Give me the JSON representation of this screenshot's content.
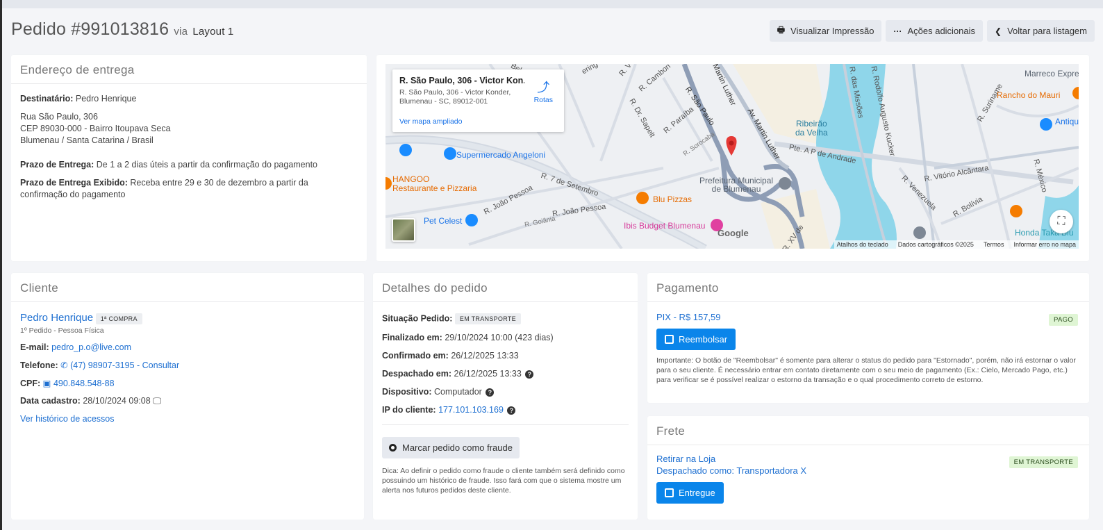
{
  "header": {
    "title": "Pedido #991013816",
    "via": "via",
    "layout": "Layout 1",
    "buttons": {
      "print": "Visualizar Impressão",
      "actions": "Ações adicionais",
      "back": "Voltar para listagem"
    }
  },
  "entrega": {
    "title": "Endereço de entrega",
    "destinatario_label": "Destinatário:",
    "destinatario": "Pedro Henrique",
    "line1": "Rua São Paulo, 306",
    "line2": "CEP 89030-000 - Bairro Itoupava Seca",
    "line3": "Blumenau / Santa Catarina / Brasil",
    "prazo_label": "Prazo de Entrega:",
    "prazo": "De 1 a 2 dias úteis a partir da confirmação do pagamento",
    "prazo_exibido_label": "Prazo de Entrega Exibido:",
    "prazo_exibido": "Receba entre 29 e 30 de dezembro a partir da confirmação do pagamento"
  },
  "map": {
    "popup_title": "R. São Paulo, 306 - Victor Kon...",
    "popup_address": "R. São Paulo, 306 - Victor Konder, Blumenau - SC, 89012-001",
    "popup_link": "Ver mapa ampliado",
    "rotas": "Rotas",
    "places": {
      "angeloni": "Supermercado Angeloni",
      "hangoo1": "HANGOO",
      "hangoo2": "Restaurante e Pizzaria",
      "petcelest": "Pet Celest",
      "blupizzas": "Blu Pizzas",
      "ibis": "Ibis Budget Blumenau",
      "prefeitura1": "Prefeitura Municipal",
      "prefeitura2": "de Blumenau",
      "ribeirao1": "Ribeirão",
      "ribeirao2": "da Velha",
      "marreco": "Marreco Express",
      "rancho": "Rancho do Mauri",
      "honda": "Honda Taka Blu",
      "antiq": "Antiqu de Blu"
    },
    "streets": {
      "saopaulo": "R. São Paulo",
      "martin": "Av. Martin Luther",
      "martin2": "Martin Luther",
      "setembro": "R. 7 de Setembro",
      "joaopessoa": "R. João Pessoa",
      "joaopessoa2": "R. João Pessoa",
      "goiania": "R. Goiânia",
      "pte": "Pte. A P de Andrade",
      "alcantara": "R. Vitório Alcântara",
      "venezuela": "R. Venezuela",
      "bolivia": "R. Bolívia",
      "missoes": "R. das Missões",
      "kucker": "R. Rodolfo Augusto Kucker",
      "paraiba": "R. Paraíba",
      "sorocaba": "R. Sorocaba",
      "sapelt": "R. Dr. Sapelt",
      "suriname": "R. Suriname",
      "mexico": "R. México",
      "xv": "R. XV de",
      "cambori": "R. Cambori",
      "ering": "ering",
      "rv": "R. V",
      "bel": "Bel"
    },
    "google": "Google",
    "footer": [
      "Atalhos do teclado",
      "Dados cartográficos ©2025",
      "Termos",
      "Informar erro no mapa"
    ]
  },
  "cliente": {
    "title": "Cliente",
    "name": "Pedro Henrique",
    "badge": "1ª COMPRA",
    "sub": "1º Pedido - Pessoa Física",
    "email_label": "E-mail:",
    "email": "pedro_p.o@live.com",
    "telefone_label": "Telefone:",
    "telefone": "(47) 98907-3195 - Consultar",
    "cpf_label": "CPF:",
    "cpf": "490.848.548-88",
    "cadastro_label": "Data cadastro:",
    "cadastro": "28/10/2024 09:08",
    "historico": "Ver histórico de acessos"
  },
  "detalhes": {
    "title": "Detalhes do pedido",
    "situacao_label": "Situação Pedido:",
    "situacao": "EM TRANSPORTE",
    "finalizado_label": "Finalizado em:",
    "finalizado": "29/10/2024 10:00 (423 dias)",
    "confirmado_label": "Confirmado em:",
    "confirmado": "26/12/2025 13:33",
    "despachado_label": "Despachado em:",
    "despachado": "26/12/2025 13:33",
    "dispositivo_label": "Dispositivo:",
    "dispositivo": "Computador",
    "ip_label": "IP do cliente:",
    "ip": "177.101.103.169",
    "fraude_btn": "Marcar pedido como fraude",
    "dica": "Dica: Ao definir o pedido como fraude o cliente também será definido como possuindo um histórico de fraude. Isso fará com que o sistema mostre um alerta nos futuros pedidos deste cliente."
  },
  "pagamento": {
    "title": "Pagamento",
    "pix": "PIX - R$ 157,59",
    "status": "PAGO",
    "reembolsar": "Reembolsar",
    "importante": "Importante: O botão de \"Reembolsar\" é somente para alterar o status do pedido para \"Estornado\", porém, não irá estornar o valor para o seu cliente. É necessário entrar em contato diretamente com o seu meio de pagamento (Ex.: Cielo, Mercado Pago, etc.) para verificar se é possível realizar o estorno da transação e o qual procedimento correto de estorno."
  },
  "frete": {
    "title": "Frete",
    "metodo": "Retirar na Loja",
    "despachado": "Despachado como: Transportadora X",
    "status": "EM TRANSPORTE",
    "entregue": "Entregue"
  },
  "colors": {
    "link": "#1d6fd1",
    "primary_button": "#0a85ea",
    "badge_green": "#dff5d4",
    "map_water": "#8fd6ea",
    "map_road": "#aab4c4"
  }
}
